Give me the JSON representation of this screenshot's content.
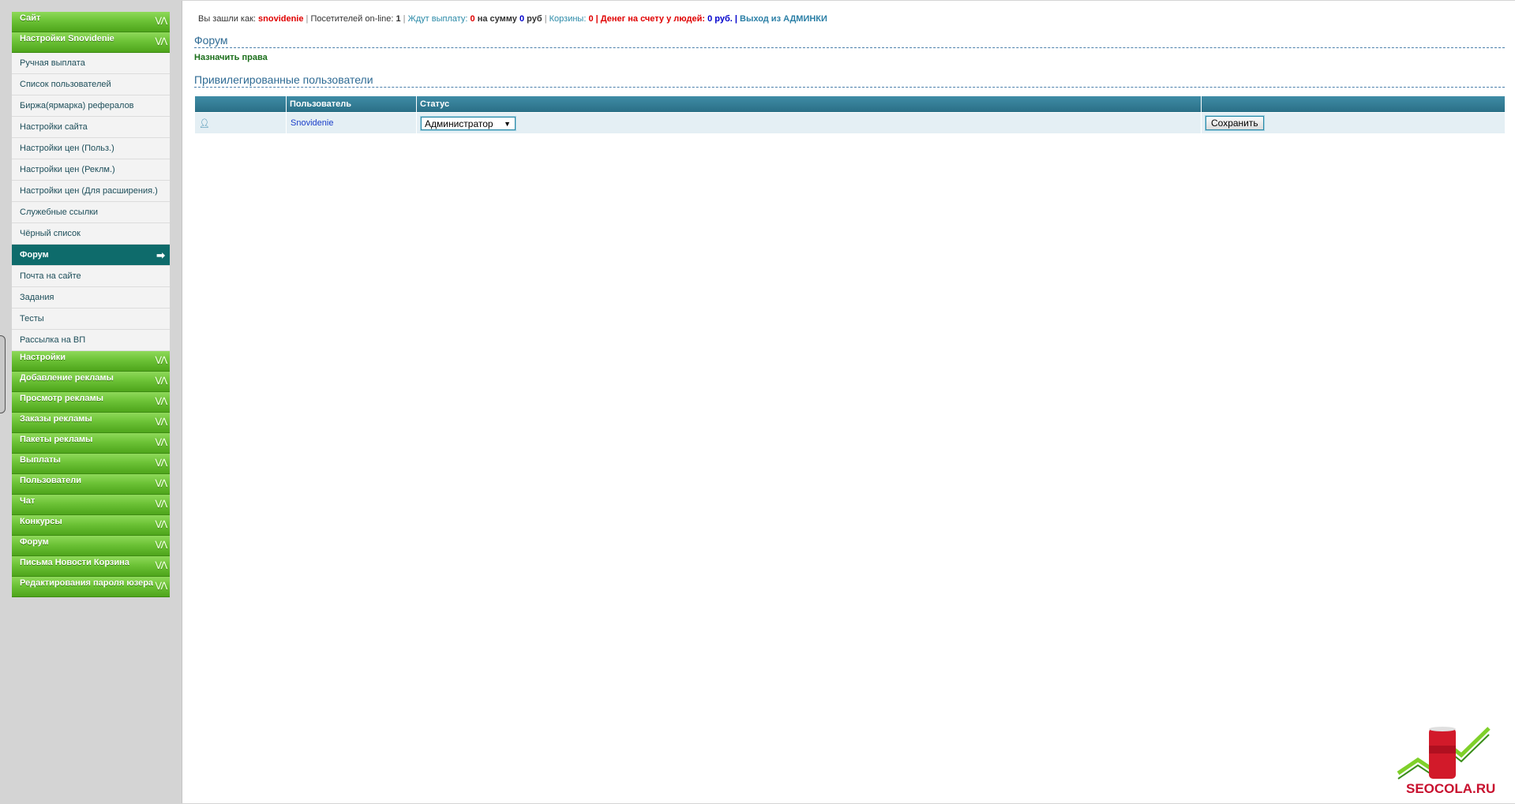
{
  "sidebar": {
    "top_groups": [
      {
        "label": "Сайт"
      },
      {
        "label": "Настройки Snovidenie"
      }
    ],
    "sub_items": [
      {
        "label": "Ручная выплата"
      },
      {
        "label": "Список пользователей"
      },
      {
        "label": "Биржа(ярмарка) рефералов"
      },
      {
        "label": "Настройки сайта"
      },
      {
        "label": "Настройки цен (Польз.)"
      },
      {
        "label": "Настройки цен (Реклм.)"
      },
      {
        "label": "Настройки цен (Для расширения.)"
      },
      {
        "label": "Служебные ссылки"
      },
      {
        "label": "Чёрный список"
      },
      {
        "label": "Форум",
        "active": true
      },
      {
        "label": "Почта на сайте"
      },
      {
        "label": "Задания"
      },
      {
        "label": "Тесты"
      },
      {
        "label": "Рассылка на ВП"
      }
    ],
    "bottom_groups": [
      {
        "label": "Настройки"
      },
      {
        "label": "Добавление рекламы"
      },
      {
        "label": "Просмотр рекламы"
      },
      {
        "label": "Заказы рекламы"
      },
      {
        "label": "Пакеты рекламы"
      },
      {
        "label": "Выплаты"
      },
      {
        "label": "Пользователи"
      },
      {
        "label": "Чат"
      },
      {
        "label": "Конкурсы"
      },
      {
        "label": "Форум"
      },
      {
        "label": "Письма Новости Корзина"
      },
      {
        "label": "Редактирования пароля юзера"
      }
    ],
    "chevron": "⋁⋀",
    "active_arrow": "➡"
  },
  "topbar": {
    "logged_as_label": "Вы зашли как:",
    "username": "snovidenie",
    "online_label": "Посетителей on-line:",
    "online_count": "1",
    "waiting_label": "Ждут выплату:",
    "waiting_count": "0",
    "sum_label": "на сумму",
    "sum_value": "0",
    "currency": "руб",
    "baskets_label": "Корзины:",
    "baskets_count": "0",
    "money_label": "| Денег на счету у людей:",
    "money_value": "0 руб.",
    "logout_label": "Выход из АДМИНКИ"
  },
  "forum": {
    "title": "Форум",
    "assign_rights": "Назначить права",
    "privileged_title": "Привилегированные пользователи",
    "table": {
      "headers": [
        "",
        "Пользователь",
        "Статус",
        ""
      ],
      "rows": [
        {
          "user": "Snovidenie",
          "status": "Администратор",
          "action": "Сохранить"
        }
      ]
    }
  },
  "logo": {
    "brand": "SEOCOLA.RU",
    "can_text": "SEO COLA"
  },
  "colors": {
    "accent_green": "#6cc236",
    "active_teal": "#0e6b6b",
    "table_header": "#3f8ca6",
    "link_blue": "#2b8aa8"
  }
}
